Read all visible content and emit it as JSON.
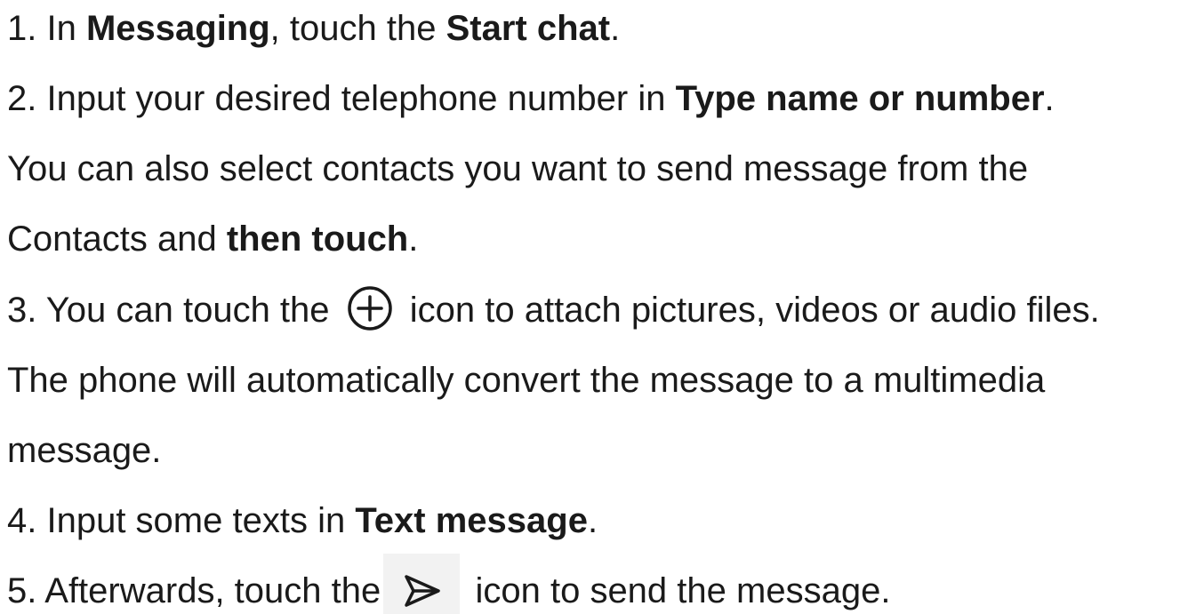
{
  "steps": [
    {
      "prefix": "1. In ",
      "bold1": "Messaging",
      "middle": ", touch the ",
      "bold2": "Start chat",
      "suffix": "."
    },
    {
      "prefix": "2. Input your desired  telephone number in ",
      "bold1": "Type name or number",
      "suffix": ".",
      "cont1": "You can also select contacts you want to send message from the",
      "cont2_prefix": "Contacts and ",
      "cont2_bold": "then touch",
      "cont2_suffix": "."
    },
    {
      "prefix": "3. You can touch the ",
      "icon": "plus-circle-icon",
      "suffix": " icon to attach pictures, videos or audio files.",
      "cont1": "The phone will automatically convert the message to a multimedia",
      "cont2": "message."
    },
    {
      "prefix": "4. Input some texts in ",
      "bold1": "Text message",
      "suffix": "."
    },
    {
      "prefix": "5. Afterwards, touch the ",
      "icon": "send-arrow-icon",
      "suffix": " icon to send the message."
    }
  ],
  "colors": {
    "text": "#1a1a1a",
    "icon_bg": "#f2f2f2"
  }
}
